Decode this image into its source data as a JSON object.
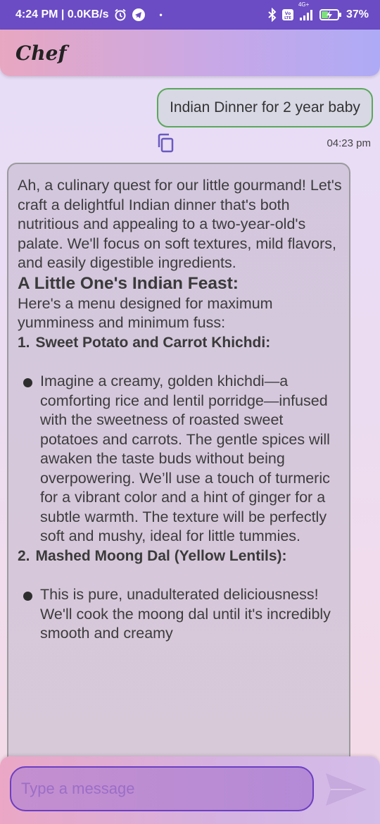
{
  "status_bar": {
    "time_speed": "4:24 PM | 0.0KB/s",
    "dot": "•",
    "network_top": "4G+",
    "battery": "37%"
  },
  "app": {
    "title": "Chef"
  },
  "chat": {
    "user_message": "Indian Dinner for 2 year baby",
    "user_time": "04:23 pm",
    "bot": {
      "intro": "Ah, a culinary quest for our little gourmand! Let's craft a delightful Indian dinner that's both nutritious and appealing to a two-year-old's palate.  We'll focus on soft textures, mild flavors, and easily digestible ingredients.",
      "heading": "A Little One's Indian Feast:",
      "menu_intro": "Here's a menu designed for maximum yumminess and minimum fuss:",
      "items": [
        {
          "number": "1.",
          "title": "Sweet Potato and Carrot Khichdi:",
          "bullet": "Imagine a creamy, golden khichdi—a comforting rice and lentil porridge—infused with the sweetness of roasted sweet potatoes and carrots.  The gentle spices will awaken the taste buds without being overpowering. We’ll use a touch of turmeric for a vibrant color and a hint of ginger for a subtle warmth.  The texture will be perfectly soft and mushy, ideal for little tummies."
        },
        {
          "number": "2.",
          "title": "Mashed Moong Dal (Yellow Lentils):",
          "bullet": "This is pure, unadulterated deliciousness!  We'll cook the moong dal until it's incredibly smooth and creamy"
        }
      ]
    }
  },
  "input": {
    "placeholder": "Type a message"
  },
  "colors": {
    "status_bar": "#6b4cc4",
    "user_bubble_border": "#5aa85a",
    "input_border": "#6b3fc2"
  },
  "icons": {
    "alarm": "alarm-icon",
    "telegram": "telegram-icon",
    "bluetooth": "bluetooth-icon",
    "volte": "volte-icon",
    "signal": "signal-icon",
    "battery": "battery-charging-icon",
    "copy": "copy-icon",
    "send": "send-icon"
  }
}
